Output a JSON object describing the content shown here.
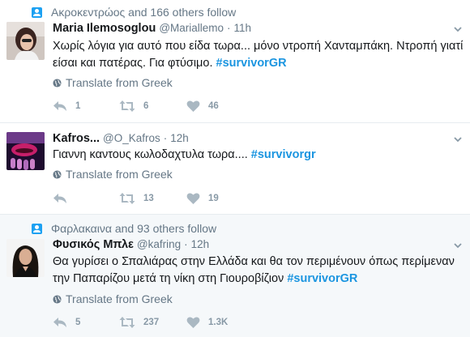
{
  "tweets": [
    {
      "context": "Ακροκεντρώος and 166 others follow",
      "name": "Maria Ilemosoglou",
      "handle": "@Mariallemo",
      "dot": "·",
      "time": "11h",
      "text": "Χωρίς λόγια για αυτό που είδα τωρα... μόνο ντροπή Χανταμπάκη. Ντροπή γιατί είσαι και πατέρας. Για φτύσιμο. ",
      "hashtag": "#survivorGR",
      "translate": "Translate from Greek",
      "replies": "1",
      "retweets": "6",
      "likes": "46"
    },
    {
      "name": "Kafros...",
      "handle": "@O_Kafros",
      "dot": "·",
      "time": "12h",
      "text": "Γιαννη καντους κωλοδαχτυλα τωρα.... ",
      "hashtag": "#survivorgr",
      "translate": "Translate from Greek",
      "replies": "",
      "retweets": "13",
      "likes": "19"
    },
    {
      "context": "Φαρλακαινα and 93 others follow",
      "name": "Φυσικός Μπλε",
      "handle": "@kafring",
      "dot": "·",
      "time": "12h",
      "text": "Θα γυρίσει ο Σπαλιάρας στην Ελλάδα και θα τον περιμένουν όπως περίμεναν την Παπαρίζου μετά τη νίκη στη Γιουροβίζιον ",
      "hashtag": "#survivorGR",
      "translate": "Translate from Greek",
      "replies": "5",
      "retweets": "237",
      "likes": "1.3K"
    }
  ],
  "colors": {
    "accent": "#1da1f2",
    "hashtag": "#1b95e0",
    "muted": "#657786",
    "highlight_bg": "#f5f8fa"
  },
  "icons": [
    "person-follow-icon",
    "globe-icon",
    "reply-icon",
    "retweet-icon",
    "heart-icon",
    "chevron-down-icon"
  ]
}
